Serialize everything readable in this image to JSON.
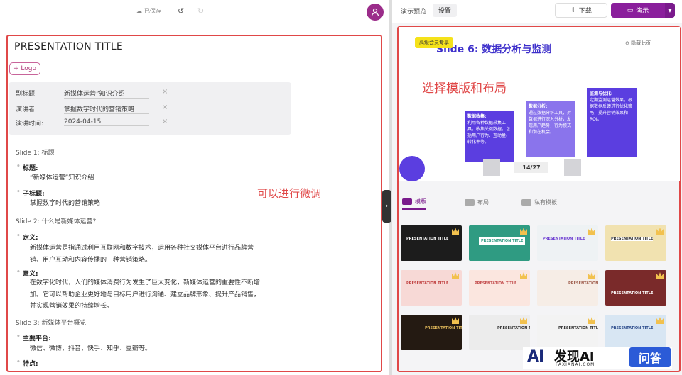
{
  "editor": {
    "saved_label": "已保存",
    "doc_title": "PRESENTATION TITLE",
    "logo_button": "+ Logo",
    "meta": [
      {
        "key": "副标题:",
        "value": "新媒体运营”知识介绍"
      },
      {
        "key": "演讲者:",
        "value": "掌握数字时代的营销策略"
      },
      {
        "key": "演讲时间:",
        "value": "2024-04-15"
      }
    ],
    "outline": {
      "s1": "Slide 1: 标题",
      "s1_b1": "标题:",
      "s1_t1": "“新媒体运营”知识介绍",
      "s1_b2": "子标题:",
      "s1_t2": "掌握数字时代的营销策略",
      "s2": "Slide 2: 什么是新媒体运营?",
      "s2_b1": "定义:",
      "s2_t1a": "新媒体运营是指通过利用互联网和数字技术，运用各种社交媒体平台进行品牌营",
      "s2_t1b": "销、用户互动和内容传播的一种营销策略。",
      "s2_b2": "意义:",
      "s2_t2a": "在数字化时代，人们的媒体消费行为发生了巨大变化，新媒体运营的重要性不断增",
      "s2_t2b": "加。它可以帮助企业更好地与目标用户进行沟通、建立品牌形象、提升产品销售，",
      "s2_t2c": "并实现营销效果的持续增长。",
      "s3": "Slide 3: 新媒体平台概览",
      "s3_b1": "主要平台:",
      "s3_t1": "微信、微博、抖音、快手、知乎、豆瓣等。",
      "s3_b2": "特点:"
    },
    "annotation": "可以进行微调"
  },
  "preview": {
    "label": "演示预览",
    "settings": "设置",
    "download": "下载",
    "present": "演示",
    "slide": {
      "badge": "高级会员专享",
      "title": "Slide 6: 数据分析与监测",
      "hide": "隐藏此页",
      "overlay": "选择模版和布局",
      "boxes": [
        {
          "head": "数据收集:",
          "body": "利用各种数据采集工具，收集关键数据，包括用户行为、互动量、转化率等。"
        },
        {
          "head": "数据分析:",
          "body": "通过数据分析工具，对数据进行深入分析，发现用户趋势，行为模式和潜在机会。"
        },
        {
          "head": "监测与优化:",
          "body": "定期监测运营效果，根据数据反馈进行优化策略，提升营销效果和ROI。"
        }
      ],
      "pager": "14/27"
    },
    "tabs": [
      "模版",
      "布局",
      "私有模板"
    ],
    "template_label": "PRESENTATION TITLE"
  },
  "watermark": {
    "logo": "AI",
    "name": "发现AI",
    "sub": "FAXIANAI.COM",
    "qa": "问答"
  },
  "colors": {
    "accent": "#8a1f9c",
    "annotation_red": "#e04848",
    "slide_title": "#3d2fcb",
    "box_purple": "#5b3ee0"
  }
}
